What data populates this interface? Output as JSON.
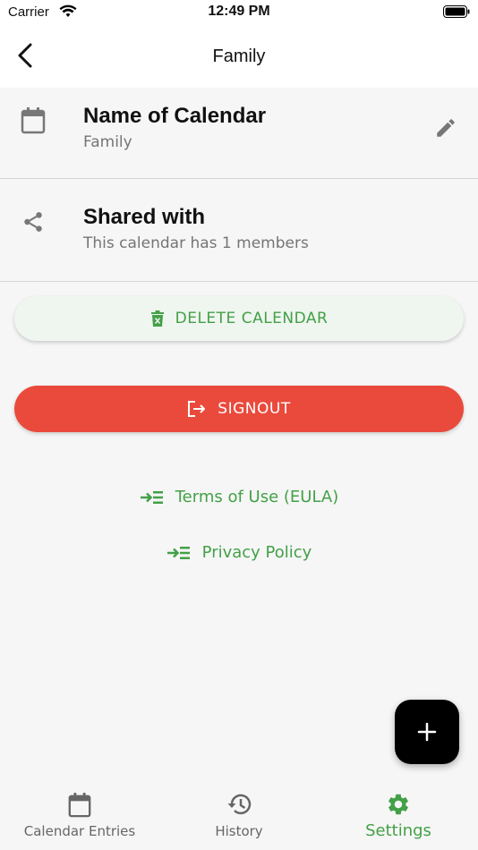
{
  "status_bar": {
    "carrier": "Carrier",
    "time": "12:49 PM"
  },
  "nav": {
    "title": "Family"
  },
  "calendar_name_row": {
    "title": "Name of Calendar",
    "value": "Family",
    "icon": "calendar-icon",
    "action_icon": "pencil-icon"
  },
  "shared_row": {
    "title": "Shared with",
    "value": "This calendar has 1 members",
    "icon": "share-icon"
  },
  "actions": {
    "delete_label": "DELETE CALENDAR",
    "signout_label": "SIGNOUT"
  },
  "links": {
    "terms": "Terms of Use (EULA)",
    "privacy": "Privacy Policy"
  },
  "tabs": [
    {
      "label": "Calendar Entries",
      "icon": "calendar-icon",
      "active": false
    },
    {
      "label": "History",
      "icon": "history-icon",
      "active": false
    },
    {
      "label": "Settings",
      "icon": "gear-icon",
      "active": true
    }
  ],
  "colors": {
    "accent_green": "#43a047",
    "signout_red": "#ea4a3c",
    "background": "#f6f6f6"
  }
}
